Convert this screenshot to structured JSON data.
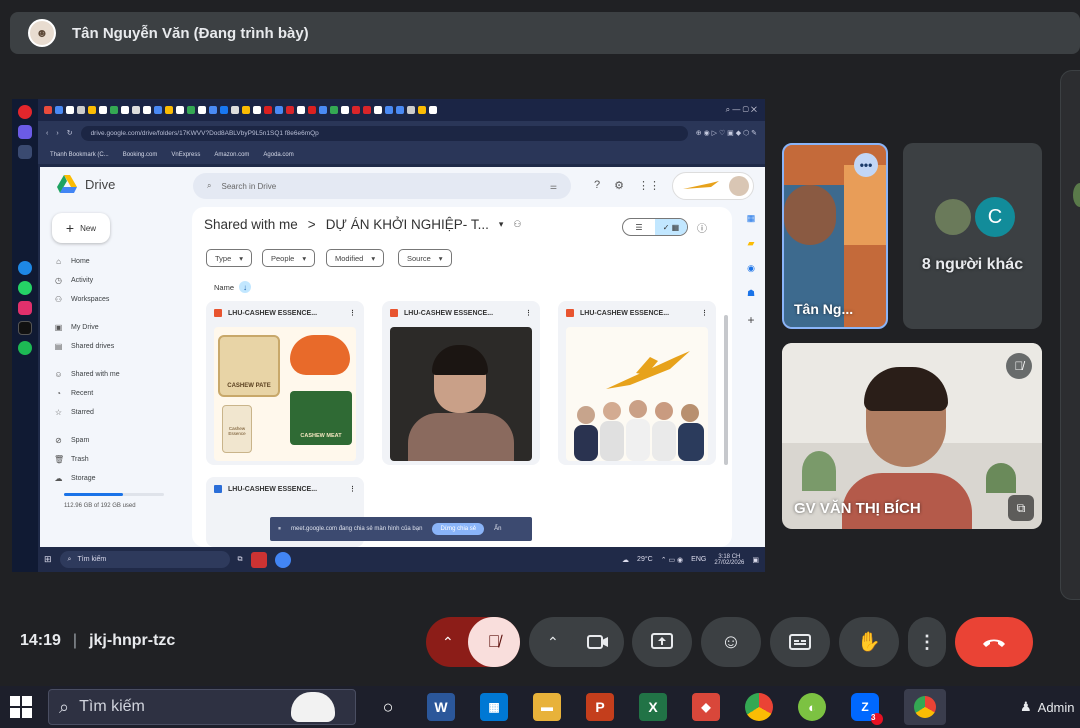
{
  "presenter": {
    "name": "Tân Nguyễn Văn (Đang trình bày)"
  },
  "browser": {
    "url": "drive.google.com/drive/folders/17KWVV?Dod8ABLVbyP9L5n1SQ1 f8e6e6mQp",
    "bookmarks": [
      "Thanh Bookmark (C...",
      "Booking.com",
      "VnExpress",
      "Amazon.com",
      "Agoda.com"
    ]
  },
  "drive": {
    "app_name": "Drive",
    "search_placeholder": "Search in Drive",
    "new_label": "New",
    "nav": [
      {
        "icon": "⌂",
        "label": "Home"
      },
      {
        "icon": "◷",
        "label": "Activity"
      },
      {
        "icon": "⚇",
        "label": "Workspaces"
      },
      {
        "icon": "▣",
        "label": "My Drive"
      },
      {
        "icon": "▤",
        "label": "Shared drives"
      },
      {
        "icon": "☺",
        "label": "Shared with me"
      },
      {
        "icon": "◔",
        "label": "Recent"
      },
      {
        "icon": "☆",
        "label": "Starred"
      },
      {
        "icon": "⊘",
        "label": "Spam"
      },
      {
        "icon": "🗑",
        "label": "Trash"
      },
      {
        "icon": "☁",
        "label": "Storage"
      }
    ],
    "storage_text": "112.96 GB of 192 GB used",
    "breadcrumb": {
      "root": "Shared with me",
      "sep": ">",
      "folder": "DỰ ÁN KHỞI NGHIỆP- T..."
    },
    "filters": [
      "Type",
      "People",
      "Modified",
      "Source"
    ],
    "sort_label": "Name",
    "files": [
      {
        "name": "LHU-CASHEW ESSENCE...",
        "icon_color": "#e8542f"
      },
      {
        "name": "LHU-CASHEW ESSENCE...",
        "icon_color": "#e8542f"
      },
      {
        "name": "LHU-CASHEW ESSENCE...",
        "icon_color": "#e8542f"
      },
      {
        "name": "LHU-CASHEW ESSENCE...",
        "icon_color": "#2b6ed8"
      }
    ],
    "thumb_texts": {
      "pate": "CASHEW PATE",
      "meat": "CASHEW MEAT",
      "brand": "Cashew Essence"
    }
  },
  "share_toast": {
    "text": "meet.google.com đang chia sẻ màn hình của bạn",
    "button": "Dừng chia sẻ",
    "hide": "Ẩn"
  },
  "inner_taskbar": {
    "search": "Tìm kiếm",
    "weather": "29°C",
    "lang": "ENG",
    "time": "3:18 CH",
    "date": "27/02/2026"
  },
  "participants": {
    "tile1_name": "Tân Ng...",
    "others_letter": "C",
    "others_label": "8 người khác",
    "speaker_name": "GV VĂN THỊ BÍCH"
  },
  "meeting": {
    "time": "14:19",
    "sep": "|",
    "code": "jkj-hnpr-tzc"
  },
  "taskbar": {
    "search": "Tìm kiếm",
    "user": "Admin"
  }
}
